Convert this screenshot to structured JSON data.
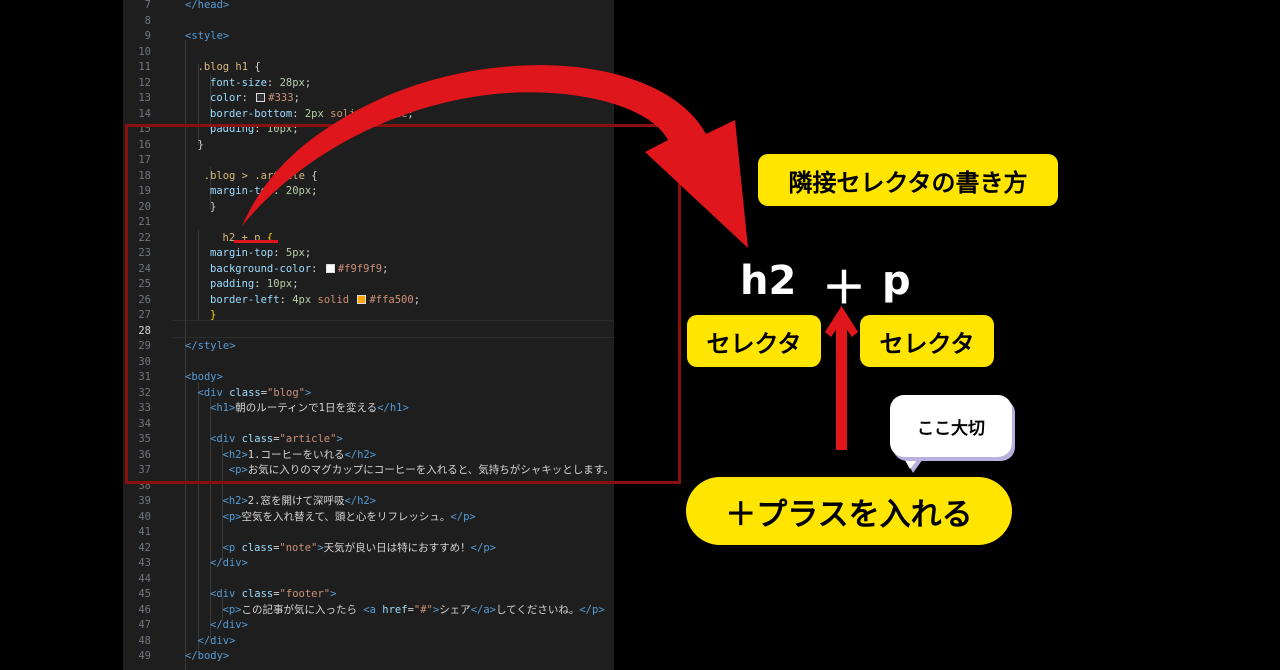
{
  "code_lines": [
    {
      "n": "7",
      "html": "<span class='tk-tag'>&lt;/head&gt;</span>",
      "indent": 0
    },
    {
      "n": "8",
      "html": "",
      "indent": 0
    },
    {
      "n": "9",
      "html": "<span class='tk-tag'>&lt;style&gt;</span>",
      "indent": 0
    },
    {
      "n": "10",
      "html": "",
      "indent": 0
    },
    {
      "n": "11",
      "html": "<span class='tk-sel'>.blog h1</span> <span class='tk-txt'>{</span>",
      "indent": 1
    },
    {
      "n": "12",
      "html": "<span class='tk-prop'>font-size</span><span class='tk-txt'>: </span><span class='tk-num'>28px</span><span class='tk-txt'>;</span>",
      "indent": 2
    },
    {
      "n": "13",
      "html": "<span class='tk-prop'>color</span><span class='tk-txt'>: </span><span class='swatch' style='background:#333'></span><span class='tk-val'>#333</span><span class='tk-txt'>;</span>",
      "indent": 2
    },
    {
      "n": "14",
      "html": "<span class='tk-prop'>border-bottom</span><span class='tk-txt'>: </span><span class='tk-num'>2px</span><span class='tk-val'> solid </span><span class='swatch' style='background:#ccc'></span><span class='tk-val'>#ccc</span><span class='tk-txt'>;</span>",
      "indent": 2
    },
    {
      "n": "15",
      "html": "<span class='tk-prop'>padding</span><span class='tk-txt'>: </span><span class='tk-num'>10px</span><span class='tk-txt'>;</span>",
      "indent": 2
    },
    {
      "n": "16",
      "html": "<span class='tk-txt'>}</span>",
      "indent": 1
    },
    {
      "n": "17",
      "html": "",
      "indent": 0
    },
    {
      "n": "18",
      "html": "<span class='tk-sel'>.blog &gt; .article</span> <span class='tk-txt'>{</span>",
      "indent": 1.5
    },
    {
      "n": "19",
      "html": "<span class='tk-prop'>margin-top</span><span class='tk-txt'>: </span><span class='tk-num'>20px</span><span class='tk-txt'>;</span>",
      "indent": 2
    },
    {
      "n": "20",
      "html": "<span class='tk-txt'>}</span>",
      "indent": 2
    },
    {
      "n": "21",
      "html": "",
      "indent": 0
    },
    {
      "n": "22",
      "html": "<span class='tk-sel'>h2 + p</span> <span class='tk-br'>{</span>",
      "indent": 3
    },
    {
      "n": "23",
      "html": "<span class='tk-prop'>margin-top</span><span class='tk-txt'>: </span><span class='tk-num'>5px</span><span class='tk-txt'>;</span>",
      "indent": 2
    },
    {
      "n": "24",
      "html": "<span class='tk-prop'>background-color</span><span class='tk-txt'>: </span><span class='swatch' style='background:#f9f9f9'></span><span class='tk-val'>#f9f9f9</span><span class='tk-txt'>;</span>",
      "indent": 2
    },
    {
      "n": "25",
      "html": "<span class='tk-prop'>padding</span><span class='tk-txt'>: </span><span class='tk-num'>10px</span><span class='tk-txt'>;</span>",
      "indent": 2
    },
    {
      "n": "26",
      "html": "<span class='tk-prop'>border-left</span><span class='tk-txt'>: </span><span class='tk-num'>4px</span><span class='tk-val'> solid </span><span class='swatch' style='background:#ffa500'></span><span class='tk-val'>#ffa500</span><span class='tk-txt'>;</span>",
      "indent": 2
    },
    {
      "n": "27",
      "html": "<span class='tk-br'>}</span>",
      "indent": 2
    },
    {
      "n": "28",
      "html": "",
      "indent": 0
    },
    {
      "n": "29",
      "html": "<span class='tk-tag'>&lt;/style&gt;</span>",
      "indent": 0
    },
    {
      "n": "30",
      "html": "",
      "indent": 0
    },
    {
      "n": "31",
      "html": "<span class='tk-tag'>&lt;body&gt;</span>",
      "indent": 0
    },
    {
      "n": "32",
      "html": "<span class='tk-tag'>&lt;div </span><span class='tk-attr'>class</span><span class='tk-txt'>=</span><span class='tk-str'>\"blog\"</span><span class='tk-tag'>&gt;</span>",
      "indent": 1
    },
    {
      "n": "33",
      "html": "<span class='tk-tag'>&lt;h1&gt;</span><span class='tk-txt'>朝のルーティンで1日を変える</span><span class='tk-tag'>&lt;/h1&gt;</span>",
      "indent": 2
    },
    {
      "n": "34",
      "html": "",
      "indent": 0
    },
    {
      "n": "35",
      "html": "<span class='tk-tag'>&lt;div </span><span class='tk-attr'>class</span><span class='tk-txt'>=</span><span class='tk-str'>\"article\"</span><span class='tk-tag'>&gt;</span>",
      "indent": 2
    },
    {
      "n": "36",
      "html": "<span class='tk-tag'>&lt;h2&gt;</span><span class='tk-txt'>1.コーヒーをいれる</span><span class='tk-tag'>&lt;/h2&gt;</span>",
      "indent": 3
    },
    {
      "n": "37",
      "html": "<span class='tk-tag'>&lt;p&gt;</span><span class='tk-txt'>お気に入りのマグカップにコーヒーを入れると、気持ちがシャキッとします。</span><span class='tk-tag'>&lt;/p&gt;</span>",
      "indent": 3.5
    },
    {
      "n": "38",
      "html": "",
      "indent": 0
    },
    {
      "n": "39",
      "html": "<span class='tk-tag'>&lt;h2&gt;</span><span class='tk-txt'>2.窓を開けて深呼吸</span><span class='tk-tag'>&lt;/h2&gt;</span>",
      "indent": 3
    },
    {
      "n": "40",
      "html": "<span class='tk-tag'>&lt;p&gt;</span><span class='tk-txt'>空気を入れ替えて、頭と心をリフレッシュ。</span><span class='tk-tag'>&lt;/p&gt;</span>",
      "indent": 3
    },
    {
      "n": "41",
      "html": "",
      "indent": 0
    },
    {
      "n": "42",
      "html": "<span class='tk-tag'>&lt;p </span><span class='tk-attr'>class</span><span class='tk-txt'>=</span><span class='tk-str'>\"note\"</span><span class='tk-tag'>&gt;</span><span class='tk-txt'>天気が良い日は特におすすめ！</span><span class='tk-tag'>&lt;/p&gt;</span>",
      "indent": 3
    },
    {
      "n": "43",
      "html": "<span class='tk-tag'>&lt;/div&gt;</span>",
      "indent": 2
    },
    {
      "n": "44",
      "html": "",
      "indent": 0
    },
    {
      "n": "45",
      "html": "<span class='tk-tag'>&lt;div </span><span class='tk-attr'>class</span><span class='tk-txt'>=</span><span class='tk-str'>\"footer\"</span><span class='tk-tag'>&gt;</span>",
      "indent": 2
    },
    {
      "n": "46",
      "html": "<span class='tk-tag'>&lt;p&gt;</span><span class='tk-txt'>この記事が気に入ったら </span><span class='tk-tag'>&lt;a </span><span class='tk-attr'>href</span><span class='tk-txt'>=</span><span class='tk-str'>\"#\"</span><span class='tk-tag'>&gt;</span><span class='tk-txt'>シェア</span><span class='tk-tag'>&lt;/a&gt;</span><span class='tk-txt'>してくださいね。</span><span class='tk-tag'>&lt;/p&gt;</span>",
      "indent": 3
    },
    {
      "n": "47",
      "html": "<span class='tk-tag'>&lt;/div&gt;</span>",
      "indent": 2
    },
    {
      "n": "48",
      "html": "<span class='tk-tag'>&lt;/div&gt;</span>",
      "indent": 1
    },
    {
      "n": "49",
      "html": "<span class='tk-tag'>&lt;/body&gt;</span>",
      "indent": 0
    }
  ],
  "current_line": "28",
  "annotation": {
    "title": "隣接セレクタの書き方",
    "formula_left": "h2",
    "formula_plus": "＋",
    "formula_right": "p",
    "left_label": "セレクタ",
    "right_label": "セレクタ",
    "bubble": "ここ大切",
    "plus_note": "＋プラスを入れる"
  },
  "colors": {
    "accent_yellow": "#ffe500",
    "arrow_red": "#e0161d",
    "highlight_box": "#8a1010"
  }
}
